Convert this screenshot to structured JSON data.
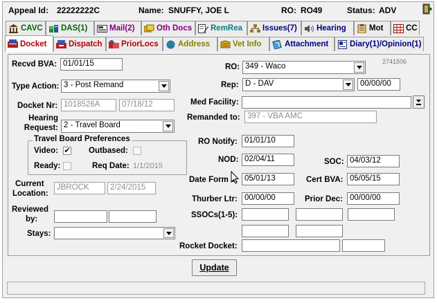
{
  "header": {
    "appeal_id_label": "Appeal Id:",
    "appeal_id": "22222222C",
    "name_label": "Name:",
    "name": "SNUFFY, JOE L",
    "ro_label": "RO:",
    "ro": "RO49",
    "status_label": "Status:",
    "status": "ADV"
  },
  "tabs_row1": [
    {
      "label": "CAVC",
      "icon": "courthouse-icon",
      "color": "#006400"
    },
    {
      "label": "DAS(1)",
      "icon": "das-icon",
      "color": "#006400"
    },
    {
      "label": "Mail(2)",
      "icon": "mail-icon",
      "color": "#800080"
    },
    {
      "label": "Oth Docs",
      "icon": "folders-icon",
      "color": "#800080"
    },
    {
      "label": "RemRea",
      "icon": "edit-doc-icon",
      "color": "#008080"
    },
    {
      "label": "Issues(7)",
      "icon": "issues-icon",
      "color": "#000080"
    },
    {
      "label": "Hearing",
      "icon": "speaker-icon",
      "color": "#000080"
    },
    {
      "label": "Mot",
      "icon": "clipboard-icon",
      "color": "#000000"
    },
    {
      "label": "CC",
      "icon": "cc-icon",
      "color": "#000000"
    }
  ],
  "tabs_row2": [
    {
      "label": "Docket",
      "icon": "docket-icon",
      "color": "#b00000"
    },
    {
      "label": "Dispatch",
      "icon": "dispatch-icon",
      "color": "#b00000"
    },
    {
      "label": "PriorLocs",
      "icon": "priorlocs-icon",
      "color": "#b00000"
    },
    {
      "label": "Address",
      "icon": "globe-icon",
      "color": "#808000"
    },
    {
      "label": "Vet Info",
      "icon": "vetinfo-icon",
      "color": "#808000"
    },
    {
      "label": "Attachment",
      "icon": "attachment-icon",
      "color": "#000080"
    },
    {
      "label": "Diary(1)/Opinion(1)",
      "icon": "diary-icon",
      "color": "#000080"
    }
  ],
  "form": {
    "recvd_bva_label": "Recvd BVA:",
    "recvd_bva": "01/01/15",
    "type_action_label": "Type Action:",
    "type_action": "3 - Post Remand",
    "docket_nr_label": "Docket Nr:",
    "docket_nr": "1018526A",
    "docket_date": "07/18/12",
    "hearing_request_label_1": "Hearing",
    "hearing_request_label_2": "Request:",
    "hearing_request": "2 - Travel Board",
    "tb_pref_legend": "Travel Board Preferences",
    "video_label": "Video:",
    "video_checked": "✔",
    "outbased_label": "Outbased:",
    "ready_label": "Ready:",
    "req_date_label": "Req Date:",
    "req_date": "1/1/2015",
    "current_location_label_1": "Current",
    "current_location_label_2": "Location:",
    "current_location": "JBROCK",
    "current_location_date": "2/24/2015",
    "reviewed_by_label_1": "Reviewed",
    "reviewed_by_label_2": "by:",
    "stays_label": "Stays:",
    "ro_label": "RO:",
    "ro": "349 - Waco",
    "ro_code": "2741506",
    "rep_label": "Rep:",
    "rep": "D - DAV",
    "rep_date": "00/00/00",
    "med_facility_label": "Med Facility:",
    "remanded_to_label": "Remanded to:",
    "remanded_to": "397 - VBA AMC",
    "ro_notify_label": "RO Notify:",
    "ro_notify": "01/01/10",
    "nod_label": "NOD:",
    "nod": "02/04/11",
    "soc_label": "SOC:",
    "soc": "04/03/12",
    "date_form_label": "Date Form 9:",
    "date_form": "05/01/13",
    "cert_bva_label": "Cert BVA:",
    "cert_bva": "05/05/15",
    "thurber_label": "Thurber Ltr:",
    "thurber": "00/00/00",
    "prior_dec_label": "Prior Dec:",
    "prior_dec": "00/00/00",
    "ssocs_label": "SSOCs(1-5):",
    "rocket_docket_label": "Rocket Docket:",
    "update_label": "Update"
  }
}
